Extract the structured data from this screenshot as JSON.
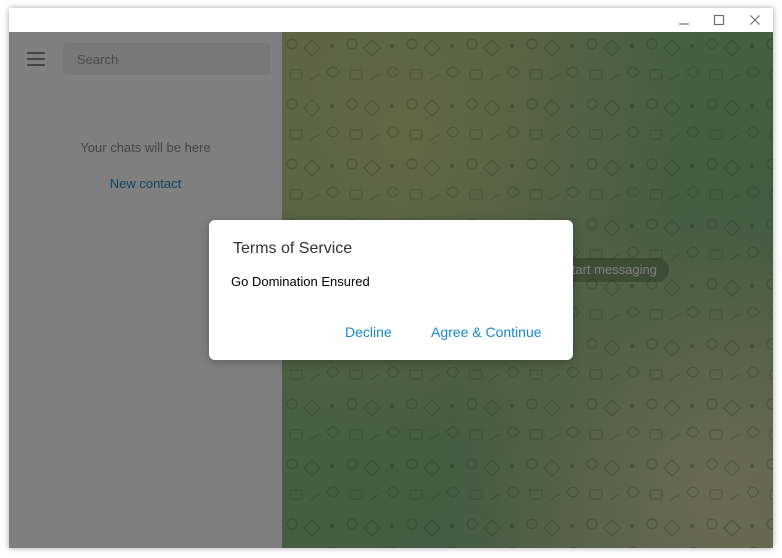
{
  "window": {
    "controls": {
      "minimize_icon": "minimize-icon",
      "maximize_icon": "maximize-icon",
      "close_icon": "close-icon"
    }
  },
  "sidebar": {
    "menu_icon": "hamburger-menu-icon",
    "search": {
      "placeholder": "Search",
      "value": ""
    },
    "empty_text": "Your chats will be here",
    "new_contact_label": "New contact"
  },
  "chat": {
    "placeholder_text": "Select a chat to start messaging"
  },
  "dialog": {
    "title": "Terms of Service",
    "text": "Go Domination Ensured",
    "decline_label": "Decline",
    "agree_label": "Agree & Continue"
  },
  "colors": {
    "accent": "#168acd",
    "overlay": "rgba(0,0,0,0.5)",
    "chat_background": "#8ebd86"
  }
}
